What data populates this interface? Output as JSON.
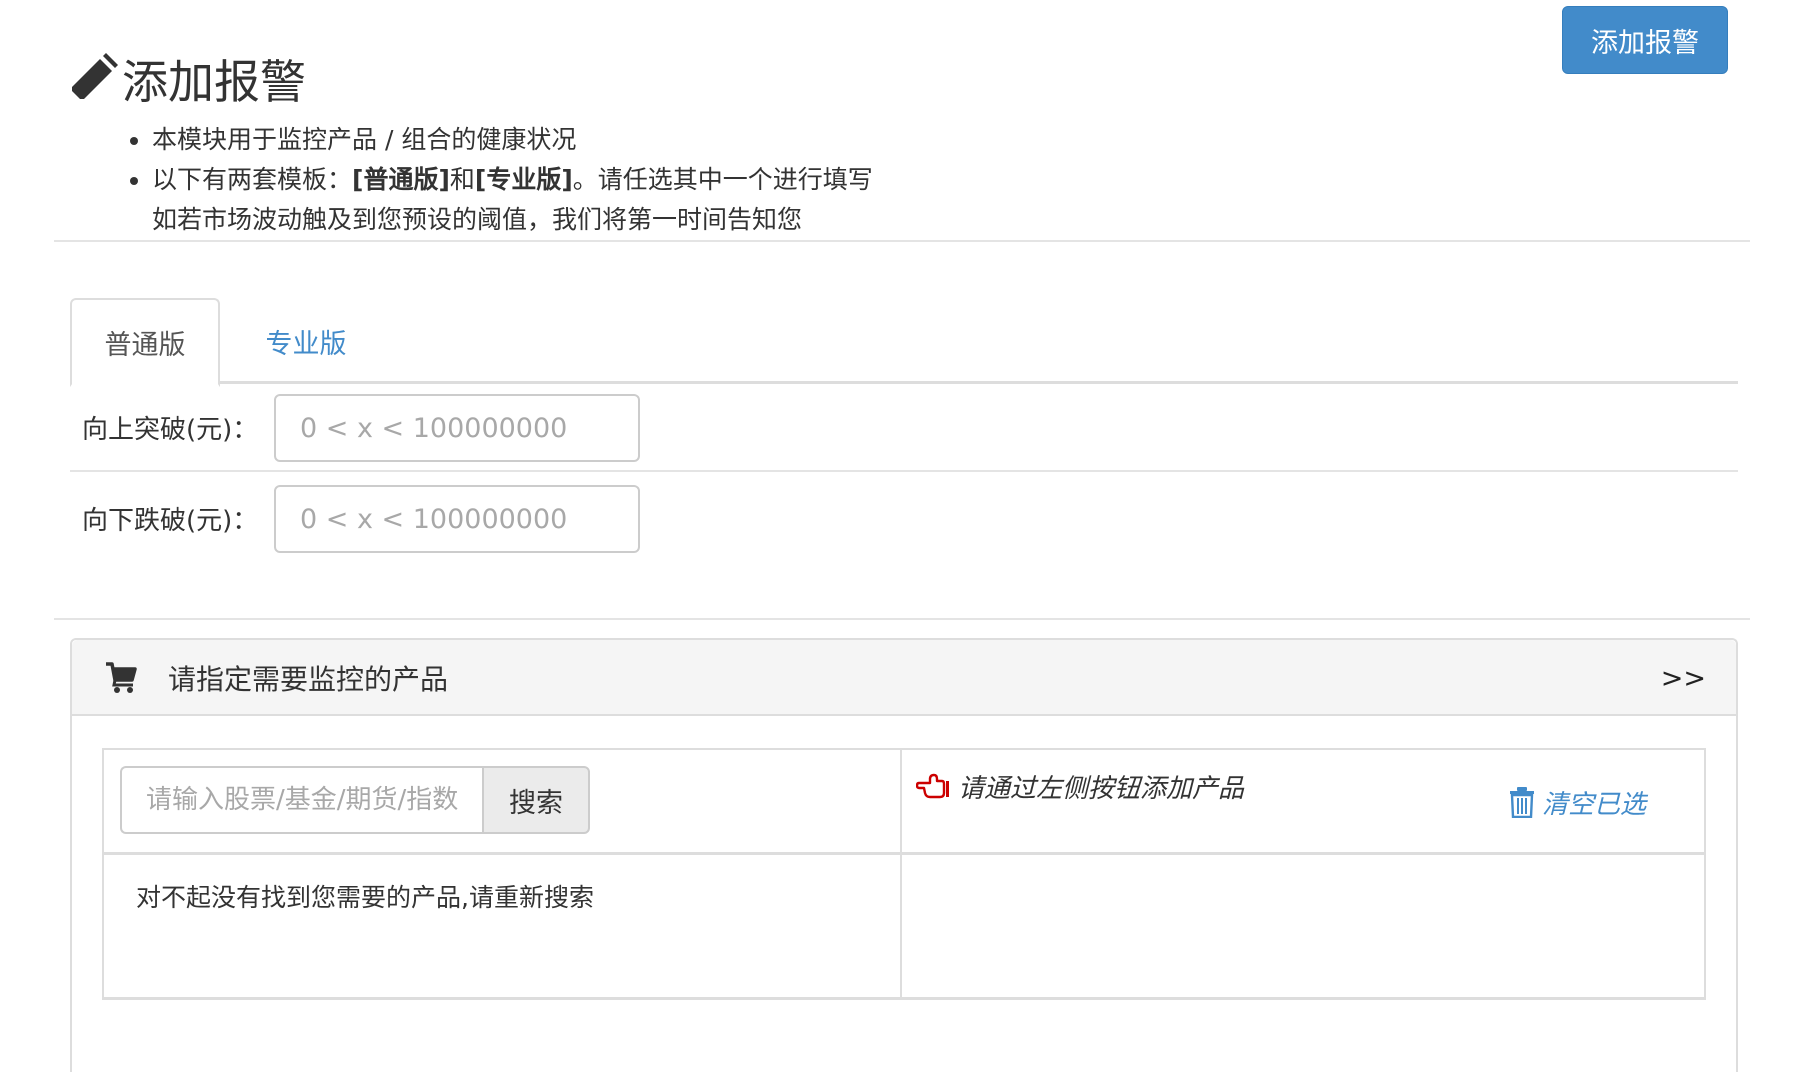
{
  "header": {
    "title": "添加报警",
    "add_button_label": "添加报警",
    "intro": {
      "line1": "本模块用于监控产品 / 组合的健康状况",
      "line2_prefix": "以下有两套模板：",
      "line2_basic": "[普通版]",
      "line2_and": "和",
      "line2_pro": "[专业版]",
      "line2_suffix": "。请任选其中一个进行填写",
      "line3": "如若市场波动触及到您预设的阈值，我们将第一时间告知您"
    }
  },
  "tabs": {
    "basic": "普通版",
    "pro": "专业版"
  },
  "form": {
    "upper": {
      "label": "向上突破(元)：",
      "placeholder": "0 < x < 100000000",
      "value": ""
    },
    "lower": {
      "label": "向下跌破(元)：",
      "placeholder": "0 < x < 100000000",
      "value": ""
    }
  },
  "product_panel": {
    "title": "请指定需要监控的产品",
    "toggle": ">>",
    "search": {
      "placeholder": "请输入股票/基金/期货/指数",
      "button": "搜索"
    },
    "hint": "请通过左侧按钮添加产品",
    "clear_label": "清空已选",
    "no_result": "对不起没有找到您需要的产品,请重新搜索"
  },
  "colors": {
    "primary": "#428bca",
    "hint_icon": "#cc0000",
    "border": "#dddddd",
    "panel_heading_bg": "#f5f5f5"
  },
  "icons": {
    "title": "pencil-icon",
    "panel": "cart-icon",
    "hint": "hand-left-icon",
    "clear": "trash-icon"
  }
}
